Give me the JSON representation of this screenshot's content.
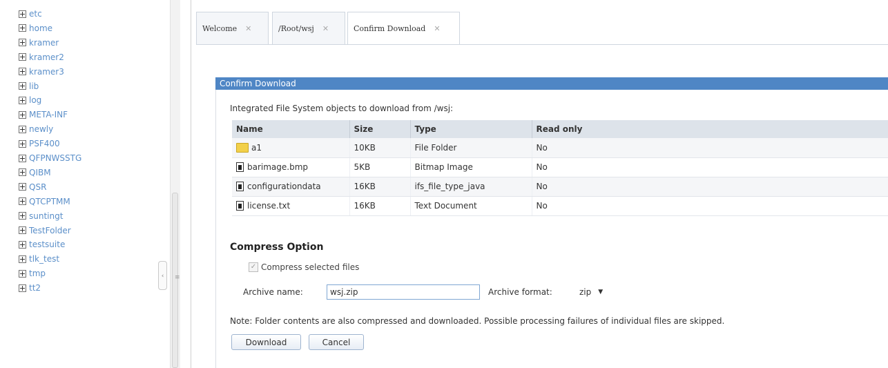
{
  "tree": {
    "items": [
      "etc",
      "home",
      "kramer",
      "kramer2",
      "kramer3",
      "lib",
      "log",
      "META-INF",
      "newly",
      "PSF400",
      "QFPNWSSTG",
      "QIBM",
      "QSR",
      "QTCPTMM",
      "suntingt",
      "TestFolder",
      "testsuite",
      "tlk_test",
      "tmp",
      "tt2"
    ]
  },
  "tabs": [
    {
      "label": "Welcome",
      "close": "✕"
    },
    {
      "label": "/Root/wsj",
      "close": "✕"
    },
    {
      "label": "Confirm Download",
      "close": "✕"
    }
  ],
  "dialog": {
    "title": "Confirm Download",
    "intro": "Integrated File System objects to download from /wsj:",
    "columns": [
      "Name",
      "Size",
      "Type",
      "Read only"
    ],
    "rows": [
      {
        "icon": "folder-icon",
        "name": "a1",
        "size": "10KB",
        "type": "File Folder",
        "read_only": "No"
      },
      {
        "icon": "file-icon",
        "name": "barimage.bmp",
        "size": "5KB",
        "type": "Bitmap Image",
        "read_only": "No"
      },
      {
        "icon": "file-icon",
        "name": "configurationdata",
        "size": "16KB",
        "type": "ifs_file_type_java",
        "read_only": "No"
      },
      {
        "icon": "file-icon",
        "name": "license.txt",
        "size": "16KB",
        "type": "Text Document",
        "read_only": "No"
      }
    ],
    "compress_heading": "Compress Option",
    "compress_label": "Compress selected files",
    "compress_checked": true,
    "archive_name_label": "Archive name:",
    "archive_name_value": "wsj.zip",
    "archive_format_label": "Archive format:",
    "archive_format_value": "zip",
    "note": "Note: Folder contents are also compressed and downloaded. Possible processing failures of individual files are skipped.",
    "download_label": "Download",
    "cancel_label": "Cancel"
  },
  "colors": {
    "accent": "#4f86c5",
    "tree_link": "#5b8fc9"
  }
}
